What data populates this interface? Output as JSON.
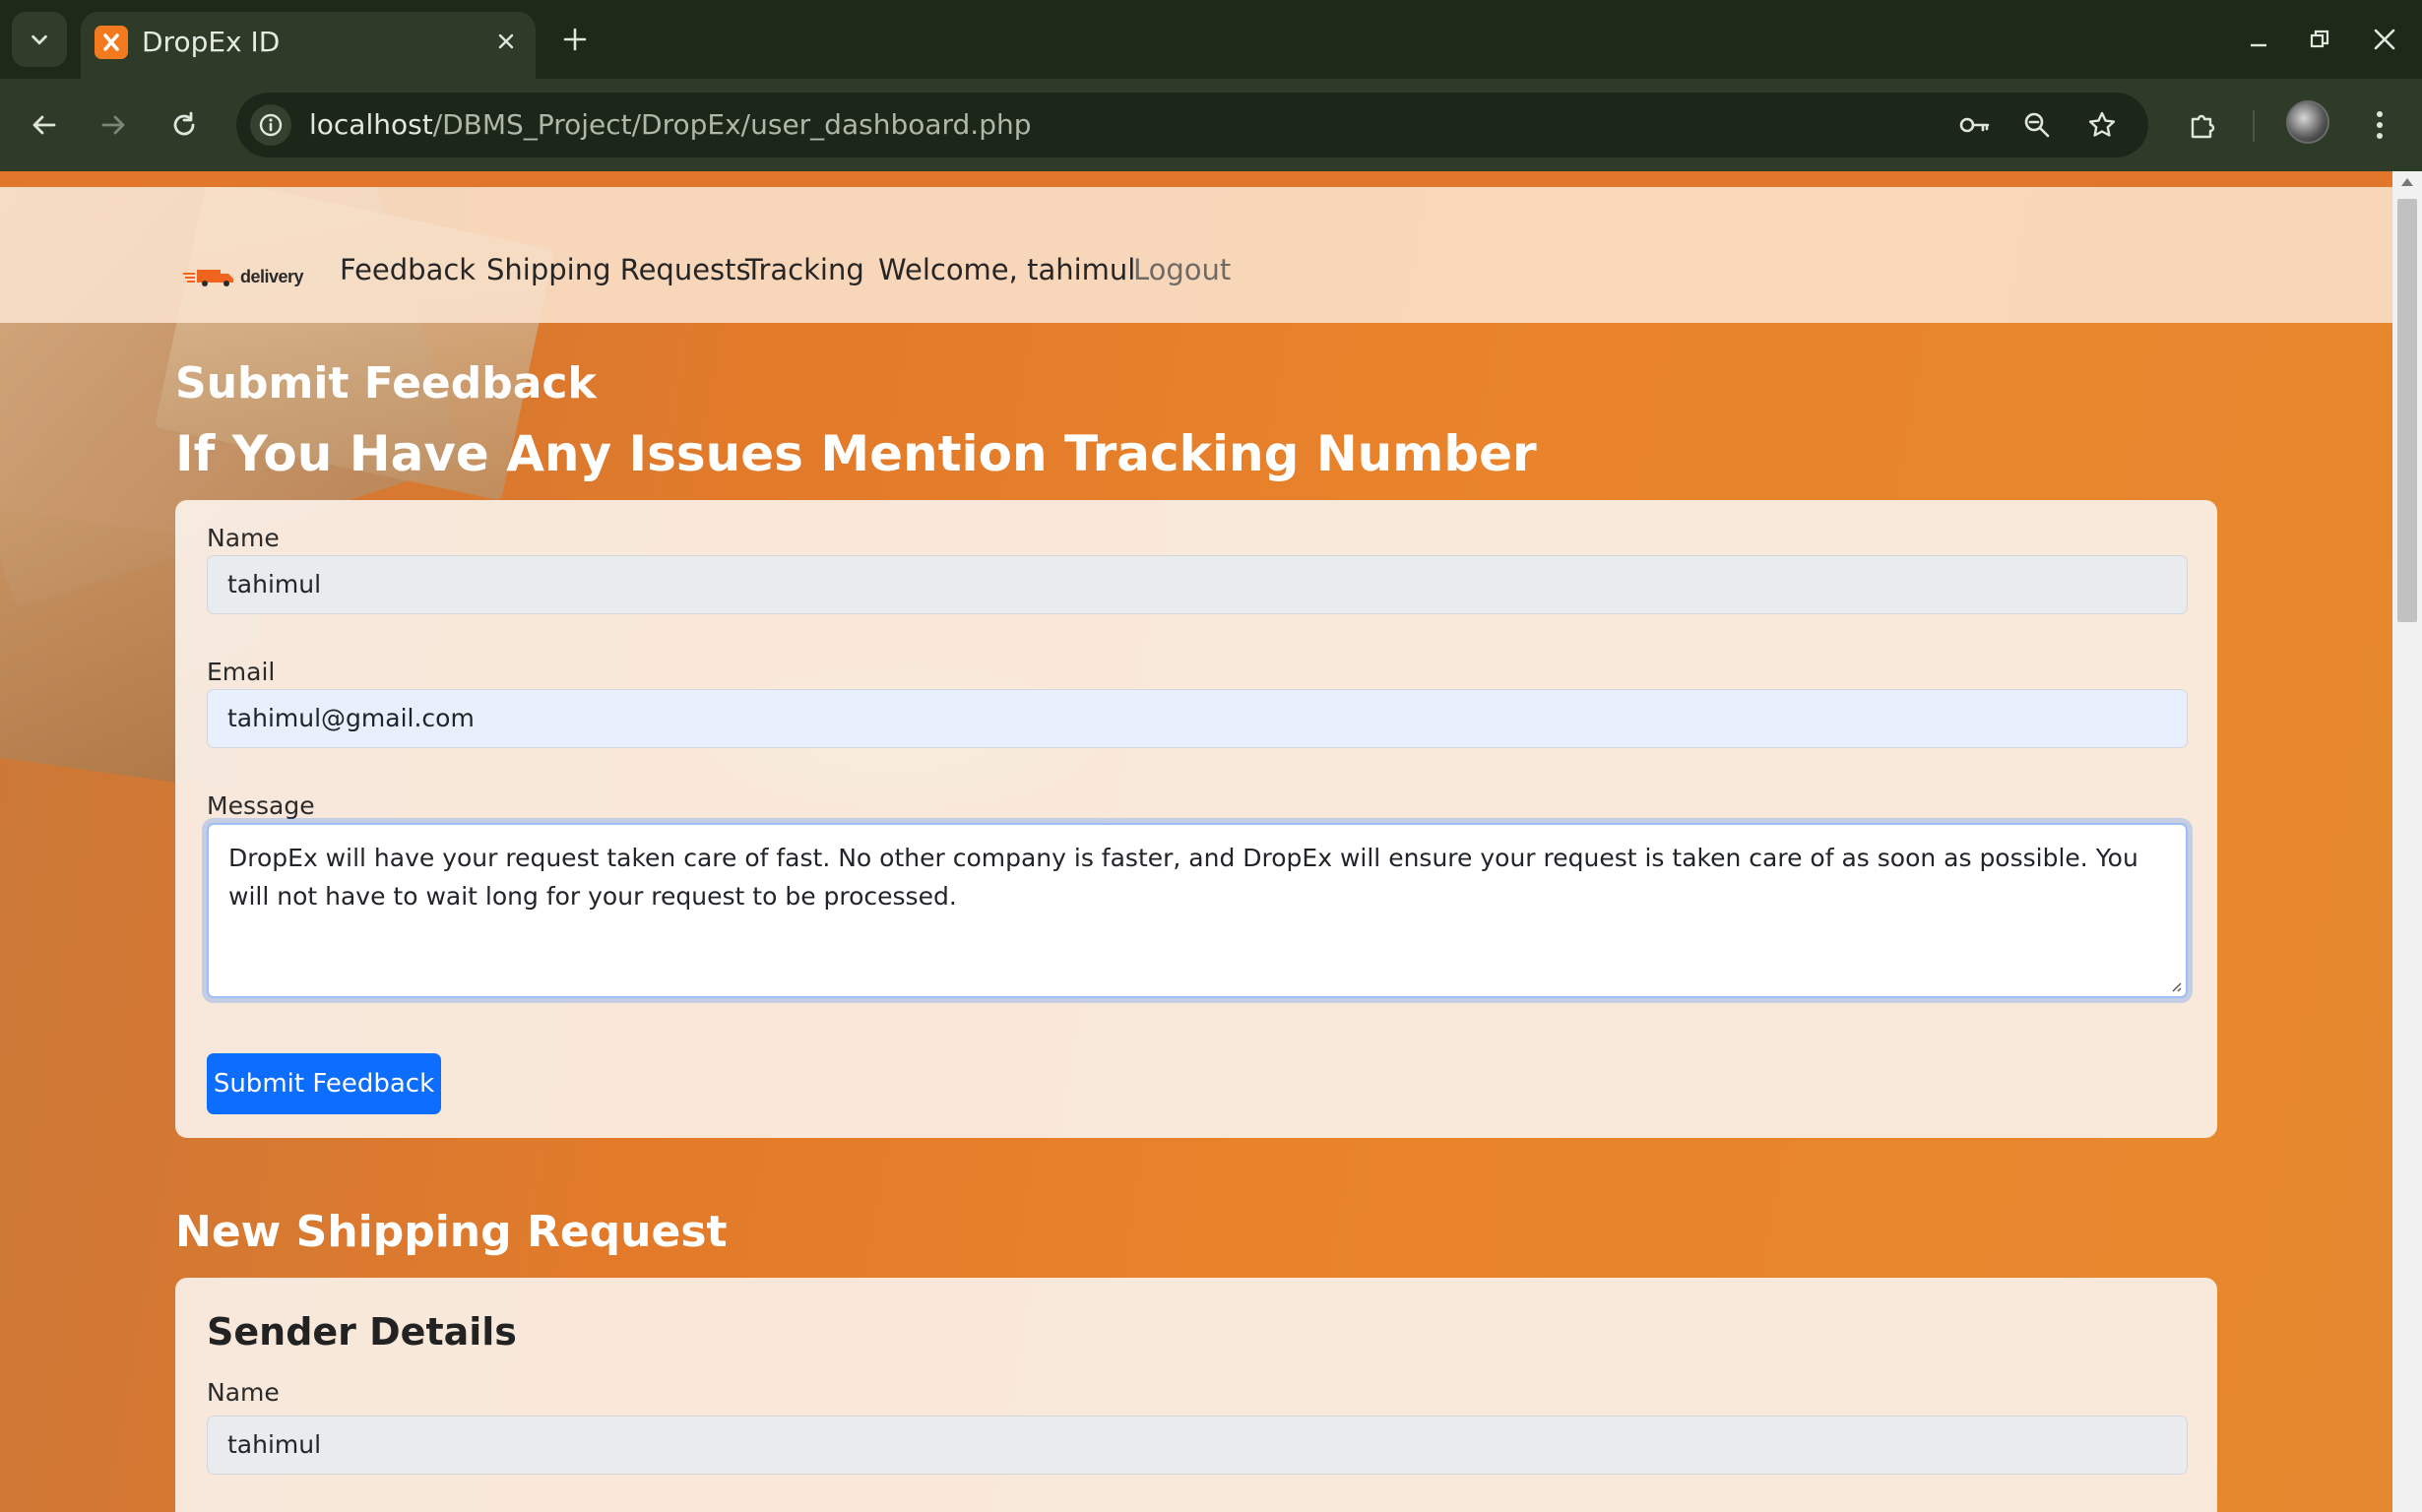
{
  "browser": {
    "tab_title": "DropEx ID",
    "url_host": "localhost",
    "url_path": "/DBMS_Project/DropEx/user_dashboard.php"
  },
  "site": {
    "brand_text": "delivery",
    "nav": {
      "feedback": "Feedback",
      "shipping_requests": "Shipping Requests",
      "tracking": "Tracking",
      "welcome": "Welcome, tahimul",
      "logout": "Logout"
    }
  },
  "feedback": {
    "title": "Submit Feedback",
    "subtitle": "If You Have Any Issues Mention Tracking Number",
    "name_label": "Name",
    "name_value": "tahimul",
    "email_label": "Email",
    "email_value": "tahimul@gmail.com",
    "message_label": "Message",
    "message_value": "DropEx will have your request taken care of fast. No other company is faster, and DropEx will ensure your request is taken care of as soon as possible. You will not have to wait long for your request to be processed.",
    "submit_label": "Submit Feedback"
  },
  "shipping": {
    "title": "New Shipping Request",
    "sender_title": "Sender Details",
    "name_label": "Name",
    "name_value": "tahimul"
  },
  "colors": {
    "primary_button": "#0d6efd",
    "page_orange": "#e9842b",
    "browser_frame": "#1d2a19"
  }
}
